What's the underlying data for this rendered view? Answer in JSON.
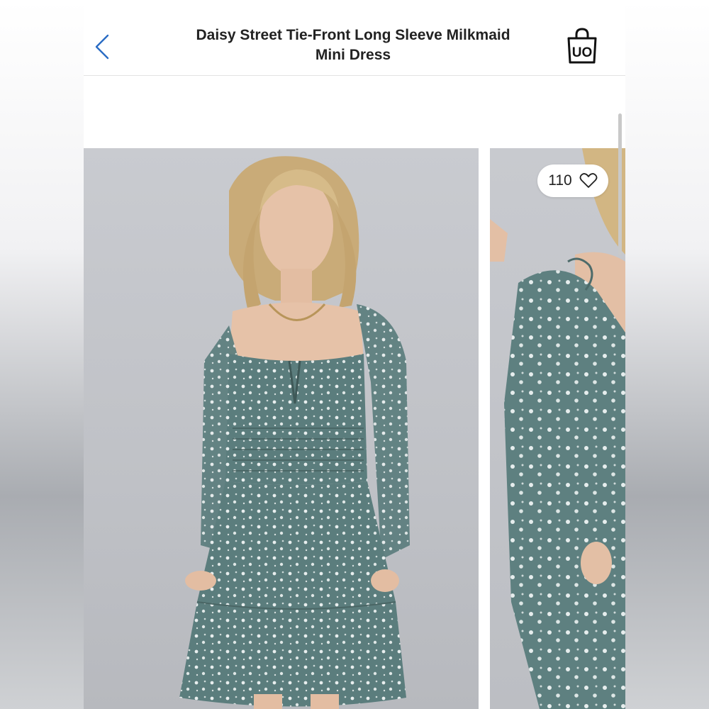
{
  "header": {
    "title_line1": "Daisy Street Tie-Front Long Sleeve Milkmaid",
    "title_line2": "Mini Dress",
    "back_icon": "chevron-left-icon",
    "bag_icon": "shopping-bag-icon",
    "bag_label": "UO"
  },
  "gallery": {
    "likes": {
      "count": "110",
      "icon": "heart-outline-icon"
    },
    "photo_main_alt": "product-photo-front",
    "photo_side_alt": "product-photo-detail"
  },
  "colors": {
    "accent": "#2a6cc4",
    "dress": "#5b7d7d",
    "text": "#222222"
  }
}
